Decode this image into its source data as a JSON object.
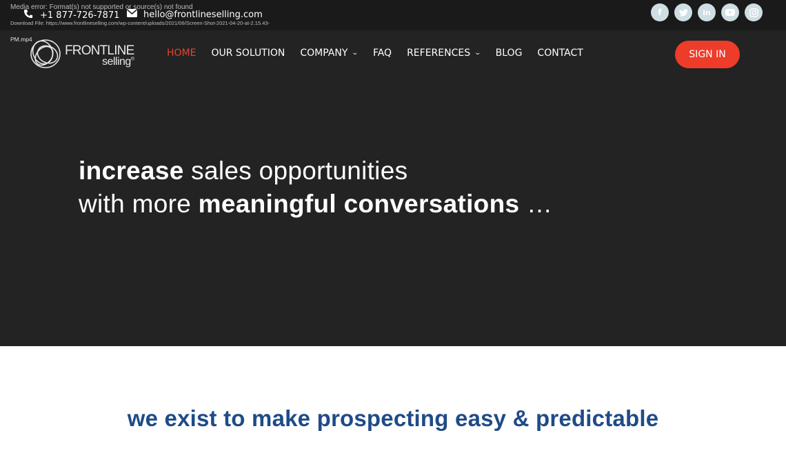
{
  "topbar": {
    "media_error": "Media error: Format(s) not supported or source(s) not found",
    "download_file": "Download File: https://www.frontlineselling.com/wp-content/uploads/2021/06/Screen-Shot-2021-04-20-at-2.15.43-",
    "download_file_cont": "PM.mp4",
    "phone": "+1 877-726-7871",
    "email": "hello@frontlineselling.com",
    "socials": [
      {
        "name": "facebook",
        "glyph": "f"
      },
      {
        "name": "twitter",
        "glyph": "t"
      },
      {
        "name": "linkedin",
        "glyph": "in"
      },
      {
        "name": "youtube",
        "glyph": "▶"
      },
      {
        "name": "instagram",
        "glyph": "◎"
      }
    ]
  },
  "logo": {
    "line1": "FRONTLINE",
    "line2": "selling",
    "mark": "®"
  },
  "nav": {
    "items": [
      {
        "label": "HOME",
        "active": true
      },
      {
        "label": "OUR SOLUTION"
      },
      {
        "label": "COMPANY",
        "dropdown": true
      },
      {
        "label": "FAQ"
      },
      {
        "label": "REFERENCES",
        "dropdown": true
      },
      {
        "label": "BLOG"
      },
      {
        "label": "CONTACT"
      }
    ],
    "chevron": "⌄",
    "signin": "SIGN IN"
  },
  "hero": {
    "w1": "increase",
    "w2": " sales opportunities",
    "w3": "with more ",
    "w4": "meaningful conversations",
    "w5": " …"
  },
  "tagline": "we exist to make prospecting easy & predictable",
  "colors": {
    "accent": "#ee3c2a",
    "active_nav": "#e8432f",
    "tagline": "#1f4b87",
    "header_bg": "#232323",
    "topbar_bg": "#1a1a1a",
    "social_bg": "#cfdee2"
  }
}
